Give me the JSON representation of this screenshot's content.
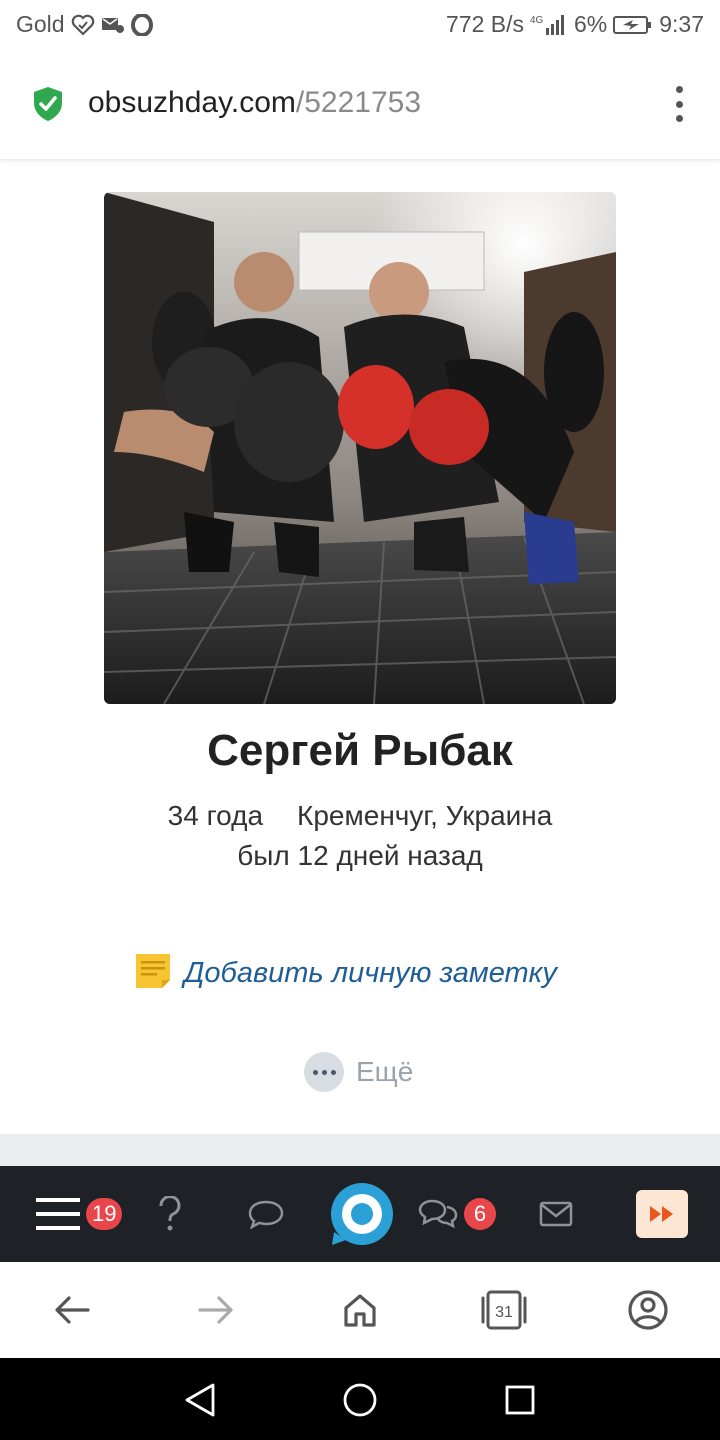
{
  "status_bar": {
    "carrier": "Gold",
    "net_speed": "772 B/s",
    "network_type": "4G",
    "battery": "6%",
    "time": "9:37",
    "icons_left": [
      "heart-shield-icon",
      "sim-manager-icon",
      "opera-icon"
    ],
    "icons_right": [
      "signal-icon",
      "battery-icon"
    ]
  },
  "browser": {
    "url_host": "obsuzhday.com",
    "url_path": "/5221753",
    "secure_icon": "shield-check-icon",
    "secure_color": "#2fa84f"
  },
  "profile": {
    "photo_alt": "Profile photo",
    "name": "Сергей Рыбак",
    "age": "34 года",
    "location": "Кременчуг, Украина",
    "last_seen": "был 12 дней назад",
    "add_note": "Добавить личную заметку",
    "more": "Ещё"
  },
  "site_nav": {
    "menu_badge": "19",
    "messages_badge": "6",
    "accent": "#2aa0d6",
    "badge_color": "#e8464b",
    "icons": [
      "menu-icon",
      "question-icon",
      "chat-bubble-icon",
      "site-logo-icon",
      "chats-icon",
      "mail-icon",
      "fast-forward-icon"
    ]
  },
  "browser_nav": {
    "tabs_count": "31",
    "icons": [
      "back-arrow-icon",
      "forward-arrow-icon",
      "home-icon",
      "tabs-icon",
      "account-icon"
    ]
  },
  "system_nav": {
    "icons": [
      "back-triangle-icon",
      "home-circle-icon",
      "recents-square-icon"
    ]
  }
}
